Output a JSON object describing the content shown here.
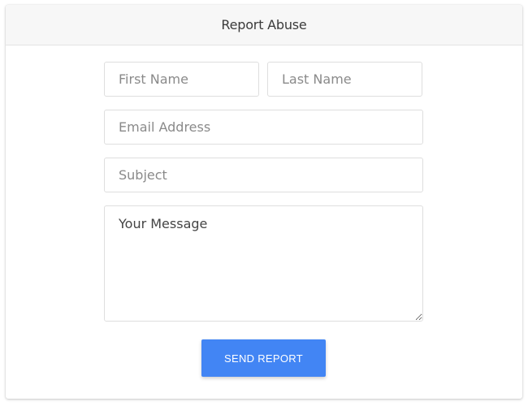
{
  "header": {
    "title": "Report Abuse"
  },
  "form": {
    "first_name_placeholder": "First Name",
    "last_name_placeholder": "Last Name",
    "email_placeholder": "Email Address",
    "subject_placeholder": "Subject",
    "message_placeholder": "Your Message",
    "submit_label": "SEND REPORT"
  },
  "colors": {
    "accent": "#4285f4",
    "header_bg": "#f7f7f7",
    "border": "#dedede"
  }
}
